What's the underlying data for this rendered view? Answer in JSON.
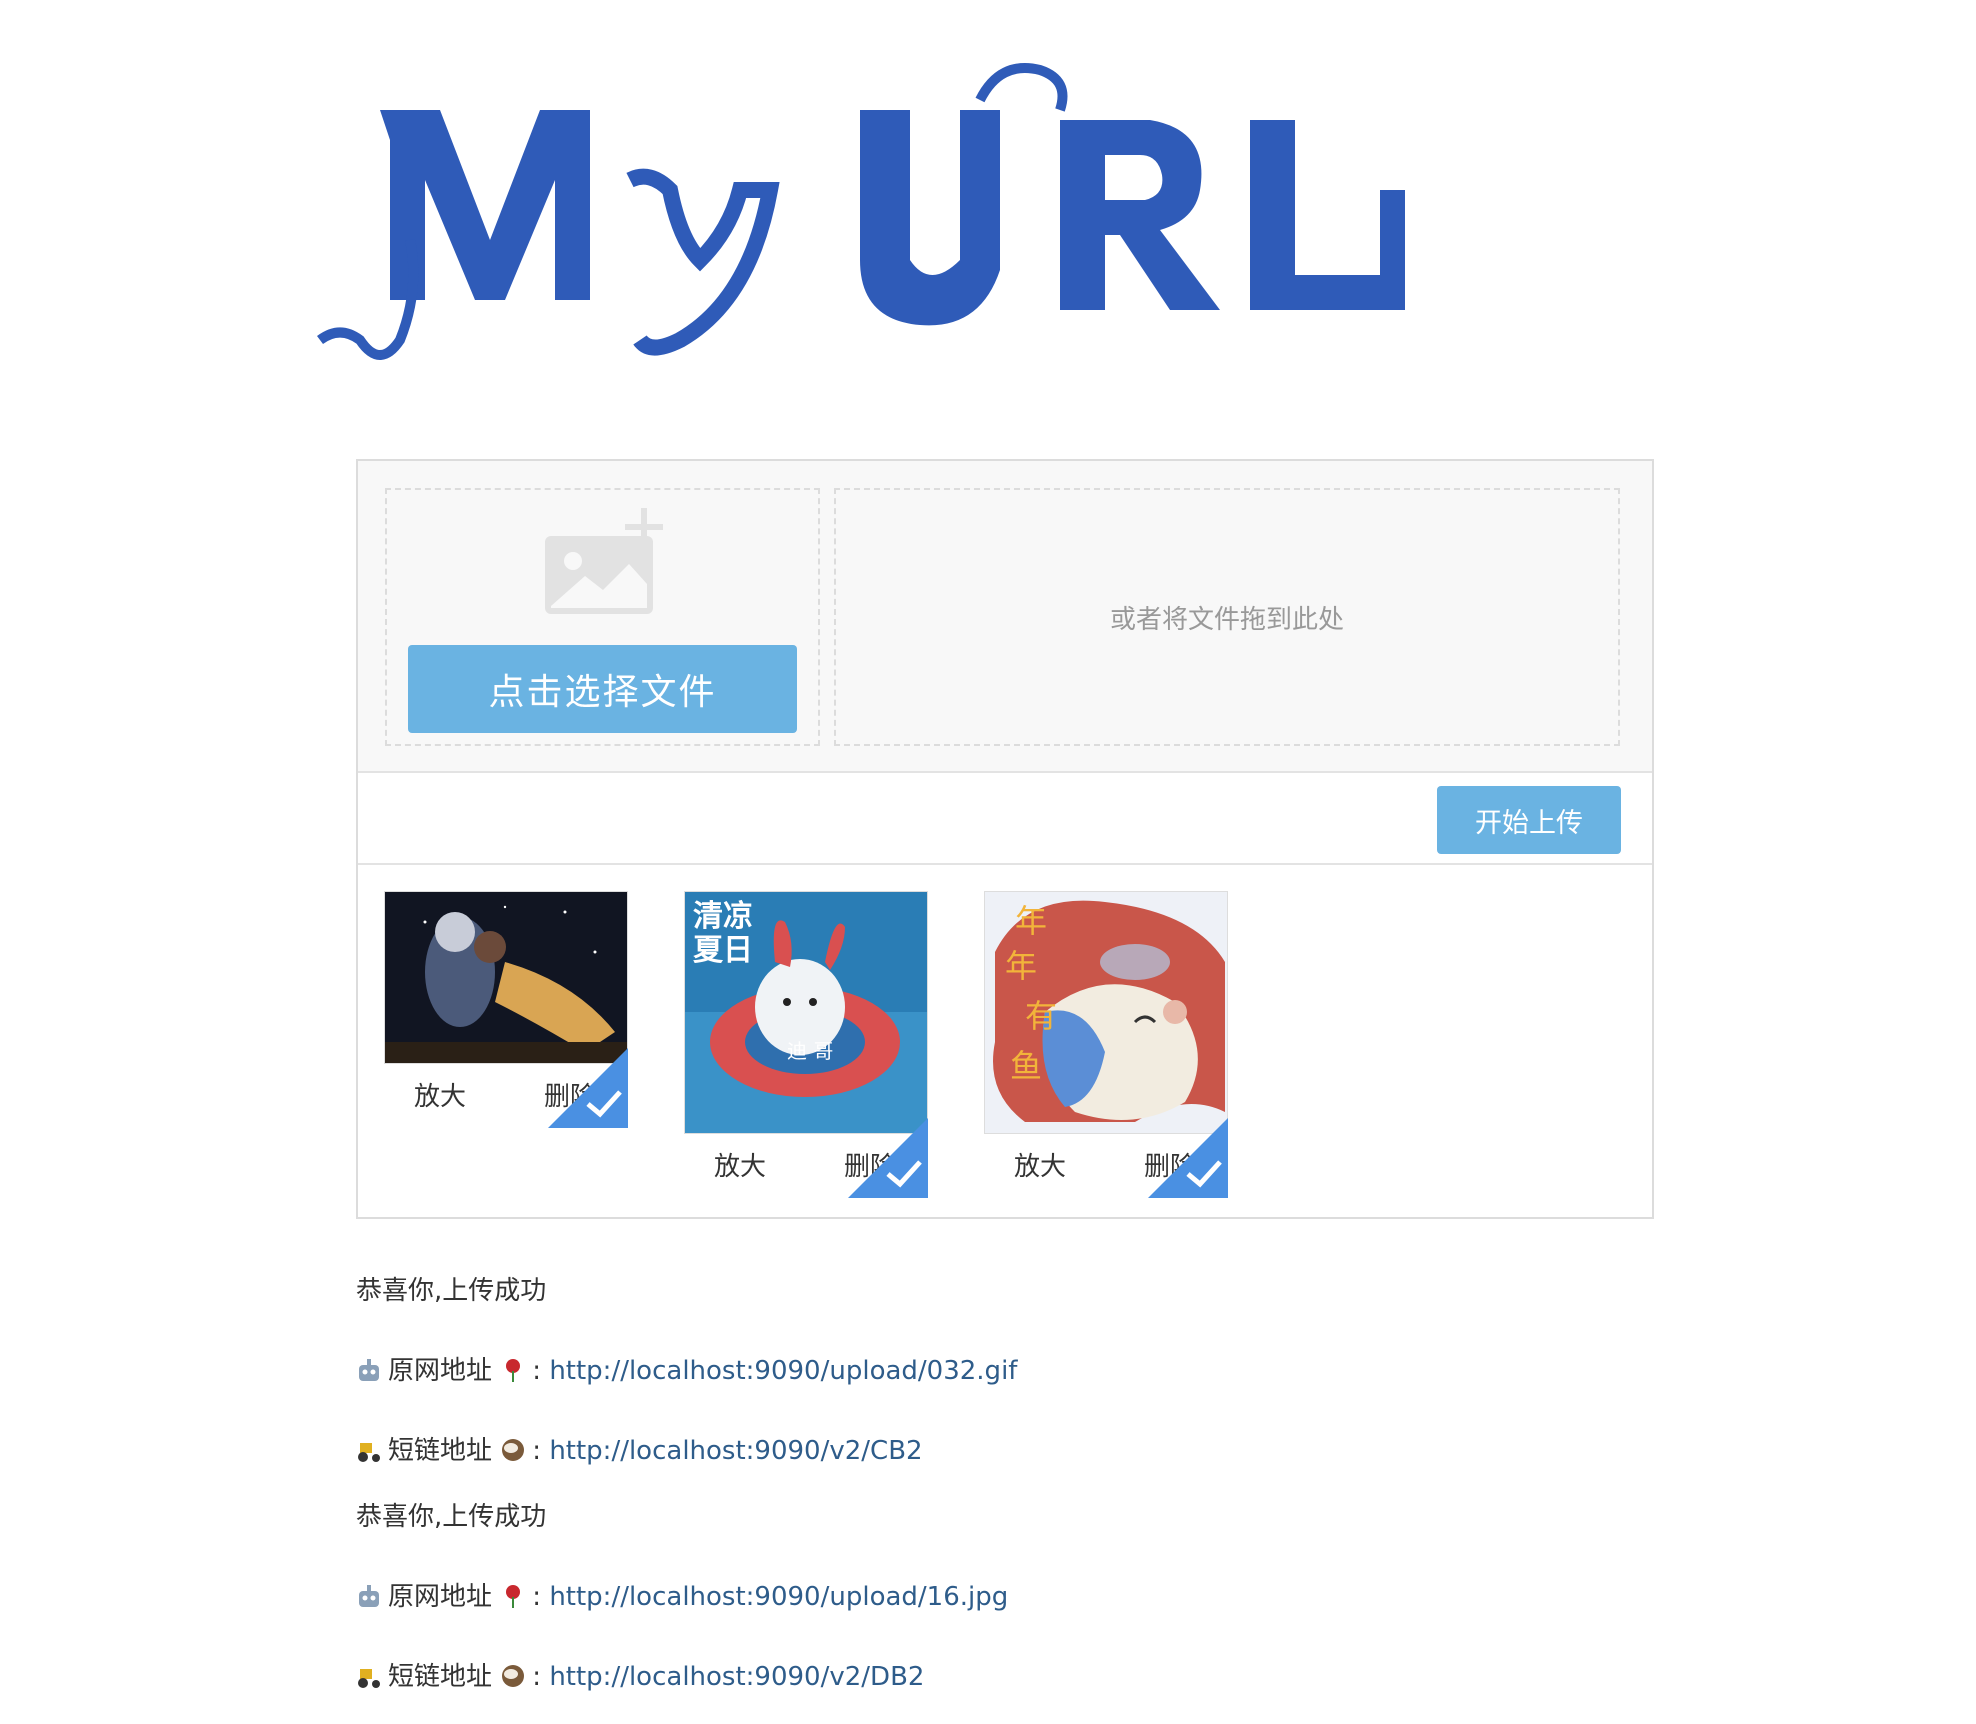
{
  "logo": {
    "text": "My URL",
    "color": "#2f5bb8"
  },
  "uploader": {
    "pick_button_label": "点击选择文件",
    "drop_hint": "或者将文件拖到此处",
    "start_button_label": "开始上传",
    "files": [
      {
        "zoom_label": "放大",
        "delete_label": "删除"
      },
      {
        "zoom_label": "放大",
        "delete_label": "删除",
        "overlay_title": "清凉夏日",
        "overlay_name": "迪哥"
      },
      {
        "zoom_label": "放大",
        "delete_label": "删除",
        "overlay_text": "年年有鱼"
      }
    ]
  },
  "results": [
    {
      "success": "恭喜你,上传成功",
      "orig_label": "原网地址",
      "orig_url": "http://localhost:9090/upload/032.gif",
      "short_label": "短链地址",
      "short_url": "http://localhost:9090/v2/CB2"
    },
    {
      "success": "恭喜你,上传成功",
      "orig_label": "原网地址",
      "orig_url": "http://localhost:9090/upload/16.jpg",
      "short_label": "短链地址",
      "short_url": "http://localhost:9090/v2/DB2"
    }
  ],
  "colors": {
    "button": "#6ab3e2",
    "link": "#2e5c8a",
    "badge": "#4a90e2"
  }
}
